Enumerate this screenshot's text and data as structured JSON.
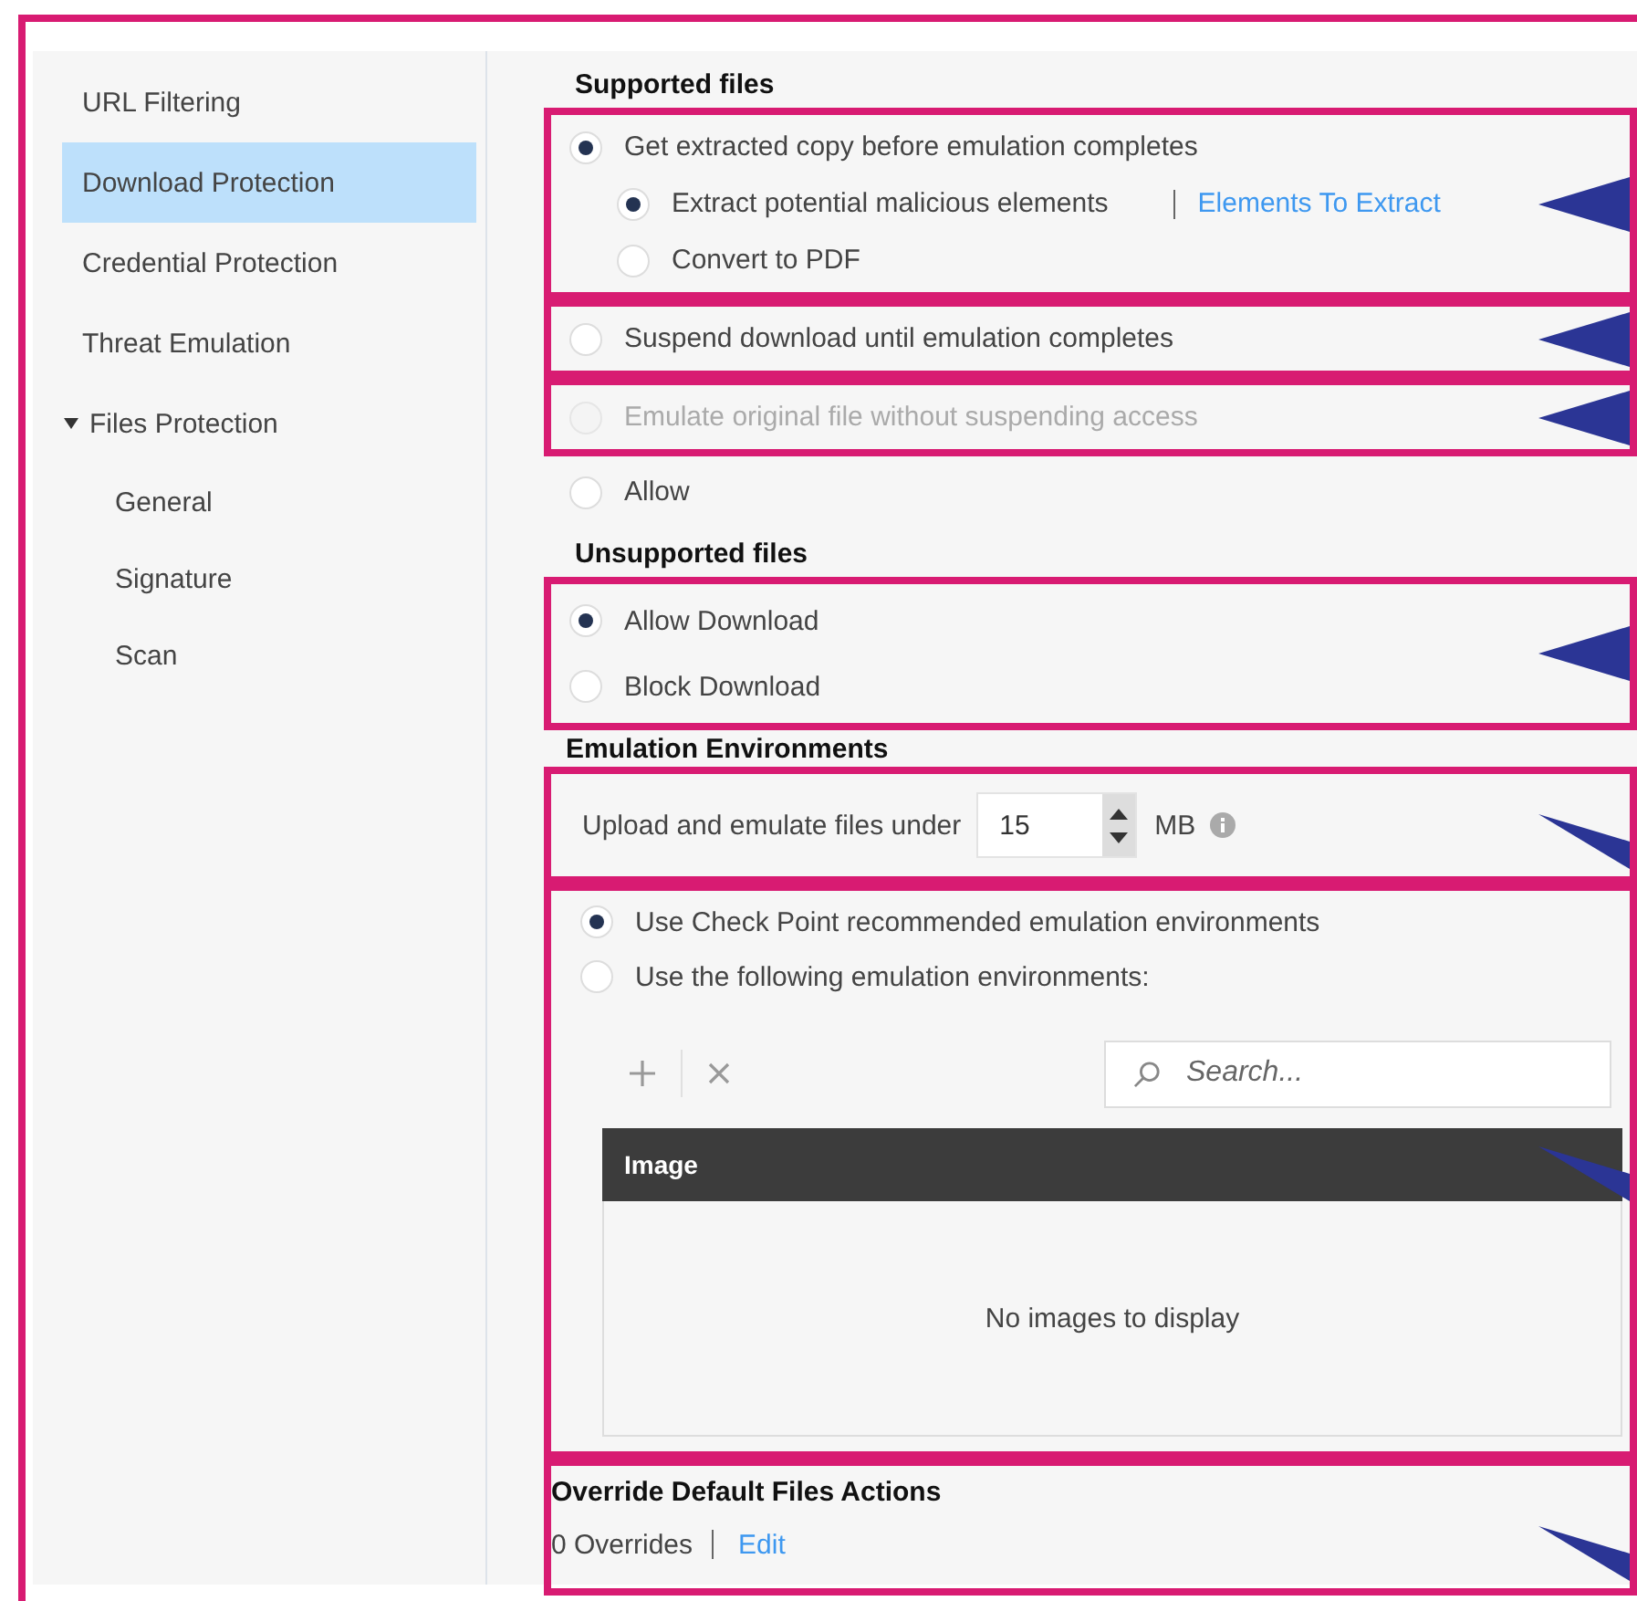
{
  "sidebar": {
    "items": [
      {
        "label": "URL Filtering",
        "selected": false
      },
      {
        "label": "Download Protection",
        "selected": true
      },
      {
        "label": "Credential Protection",
        "selected": false
      },
      {
        "label": "Threat Emulation",
        "selected": false
      },
      {
        "label": "Files Protection",
        "selected": false,
        "expanded": true,
        "children": [
          {
            "label": "General",
            "selected": false
          },
          {
            "label": "Signature",
            "selected": false
          },
          {
            "label": "Scan",
            "selected": false
          }
        ]
      }
    ]
  },
  "supported_files": {
    "title": "Supported files",
    "options": [
      {
        "label": "Get extracted copy before emulation completes",
        "selected": true,
        "disabled": false,
        "children": [
          {
            "label": "Extract potential malicious elements",
            "selected": true,
            "disabled": false,
            "link": "Elements To Extract"
          },
          {
            "label": "Convert to PDF",
            "selected": false,
            "disabled": false
          }
        ]
      },
      {
        "label": "Suspend download until emulation completes",
        "selected": false,
        "disabled": false
      },
      {
        "label": "Emulate original file without suspending access",
        "selected": false,
        "disabled": true
      },
      {
        "label": "Allow",
        "selected": false,
        "disabled": false
      }
    ]
  },
  "unsupported_files": {
    "title": "Unsupported files",
    "options": [
      {
        "label": "Allow Download",
        "selected": true,
        "disabled": false
      },
      {
        "label": "Block Download",
        "selected": false,
        "disabled": false
      }
    ]
  },
  "emulation": {
    "title": "Emulation Environments",
    "size_label": "Upload and emulate files under",
    "size_value": "15",
    "unit": "MB",
    "options": [
      {
        "label": "Use Check Point recommended emulation environments",
        "selected": true,
        "disabled": false
      },
      {
        "label": "Use the following emulation environments:",
        "selected": false,
        "disabled": false
      }
    ],
    "search": {
      "placeholder": "Search..."
    },
    "table": {
      "columns": [
        "Image"
      ],
      "empty_text": "No images to display"
    }
  },
  "overrides": {
    "title": "Override Default Files Actions",
    "count": "0 Overrides",
    "link": "Edit"
  }
}
